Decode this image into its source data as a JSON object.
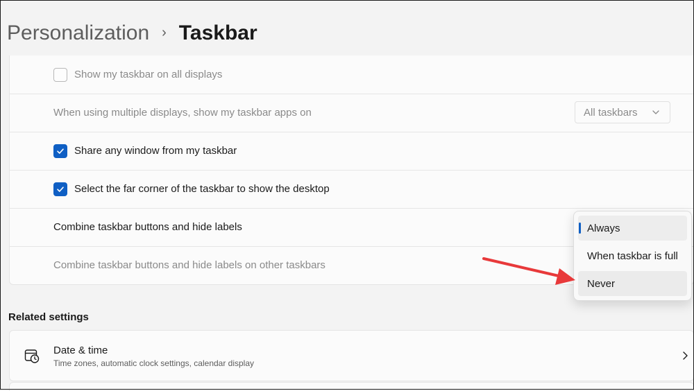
{
  "breadcrumb": {
    "parent": "Personalization",
    "separator": "›",
    "current": "Taskbar"
  },
  "settings": {
    "rows": [
      {
        "label": "Show my taskbar on all displays",
        "checked": false,
        "enabled": false
      },
      {
        "label": "When using multiple displays, show my taskbar apps on",
        "enabled": false,
        "dropdown_value": "All taskbars"
      },
      {
        "label": "Share any window from my taskbar",
        "checked": true,
        "enabled": true
      },
      {
        "label": "Select the far corner of the taskbar to show the desktop",
        "checked": true,
        "enabled": true
      },
      {
        "label": "Combine taskbar buttons and hide labels",
        "enabled": true
      },
      {
        "label": "Combine taskbar buttons and hide labels on other taskbars",
        "enabled": false
      }
    ]
  },
  "combine_menu": {
    "options": [
      "Always",
      "When taskbar is full",
      "Never"
    ],
    "selected": "Always",
    "hovered": "Never"
  },
  "related_settings": {
    "heading": "Related settings",
    "items": [
      {
        "title": "Date & time",
        "subtitle": "Time zones, automatic clock settings, calendar display",
        "icon": "calendar-clock-icon"
      }
    ]
  },
  "colors": {
    "accent": "#0f5fc4",
    "annotation_arrow": "#e8393a"
  }
}
